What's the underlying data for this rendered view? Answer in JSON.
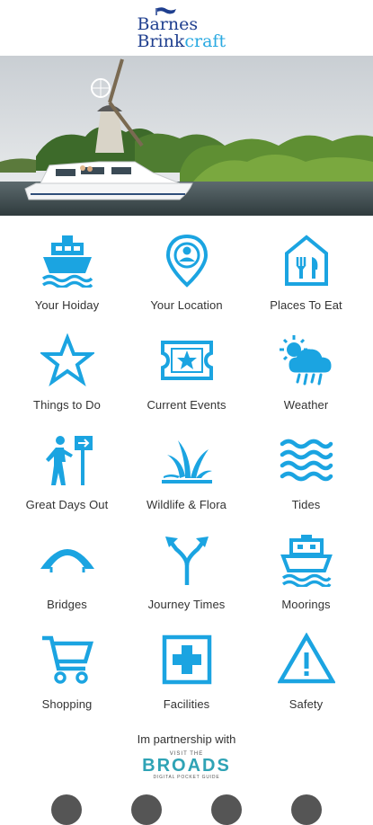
{
  "brand": {
    "line1": "Barnes",
    "line2a": "Brink",
    "line2b": "craft"
  },
  "colors": {
    "icon": "#1ba4e1",
    "navy": "#1f3f8f"
  },
  "menu": [
    {
      "label": "Your Hoiday",
      "icon": "boat-icon"
    },
    {
      "label": "Your Location",
      "icon": "location-pin-icon"
    },
    {
      "label": "Places To Eat",
      "icon": "restaurant-icon"
    },
    {
      "label": "Things to Do",
      "icon": "star-icon"
    },
    {
      "label": "Current Events",
      "icon": "ticket-icon"
    },
    {
      "label": "Weather",
      "icon": "weather-icon"
    },
    {
      "label": "Great Days Out",
      "icon": "hiker-signpost-icon"
    },
    {
      "label": "Wildlife & Flora",
      "icon": "grass-icon"
    },
    {
      "label": "Tides",
      "icon": "waves-icon"
    },
    {
      "label": "Bridges",
      "icon": "bridge-icon"
    },
    {
      "label": "Journey Times",
      "icon": "split-arrows-icon"
    },
    {
      "label": "Moorings",
      "icon": "boat-water-icon"
    },
    {
      "label": "Shopping",
      "icon": "cart-icon"
    },
    {
      "label": "Facilities",
      "icon": "first-aid-icon"
    },
    {
      "label": "Safety",
      "icon": "warning-icon"
    }
  ],
  "partner": {
    "text": "Im partnership with",
    "logo_small": "VISIT THE",
    "logo_big": "BROADS",
    "logo_sub": "DIGITAL POCKET GUIDE"
  }
}
